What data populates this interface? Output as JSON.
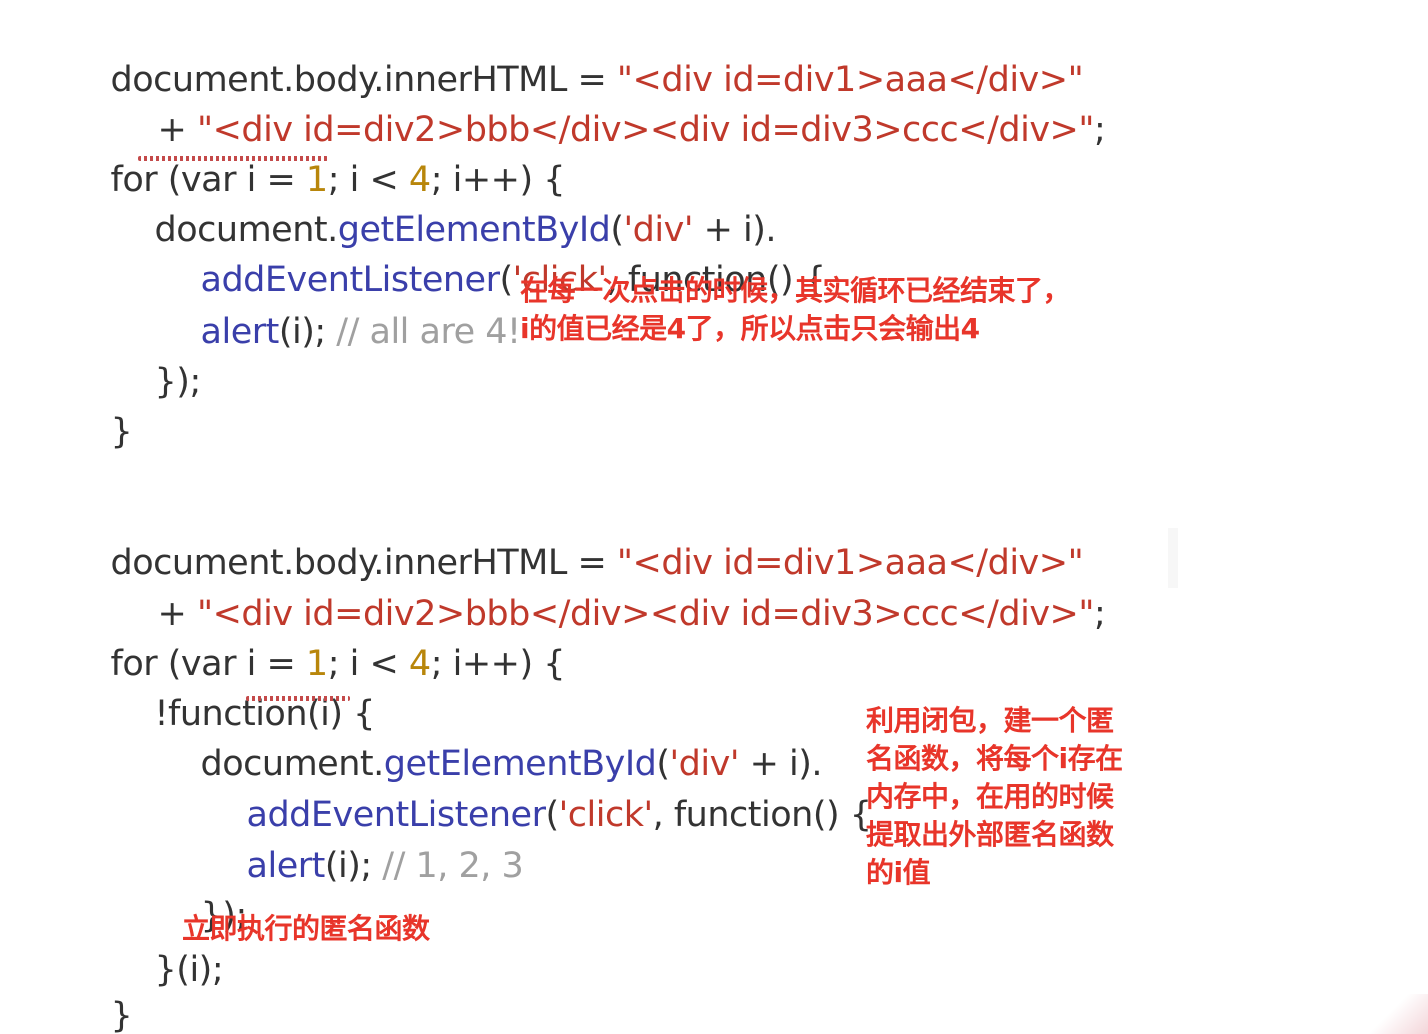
{
  "block1": {
    "line1": {
      "a": "document.body.innerHTML = ",
      "b": "\"<div id=div1>aaa</div>\""
    },
    "line2": {
      "a": "+ ",
      "b": "\"<div id=div2>bbb</div><div id=div3>ccc</div>\"",
      "c": ";"
    },
    "line3": {
      "a": "for (var i = ",
      "n1": "1",
      "b": "; i < ",
      "n2": "4",
      "c": "; i++) {"
    },
    "line4": {
      "a": "document.",
      "f": "getElementById",
      "b": "(",
      "s": "'div'",
      "c": " + i)."
    },
    "line5": {
      "f": "addEventListener",
      "b": "(",
      "s": "'click'",
      "c": ", function() {"
    },
    "line6": {
      "f": "alert",
      "b": "(i); ",
      "cmt": "// all are 4!"
    },
    "line7": "});",
    "line8": "}",
    "note": {
      "line1": "在每一次点击的时候，其实循环已经结束了，",
      "line2": "i的值已经是4了，所以点击只会输出4"
    }
  },
  "block2": {
    "line1": {
      "a": "document.body.innerHTML = ",
      "b": "\"<div id=div1>aaa</div>\""
    },
    "line2": {
      "a": "+ ",
      "b": "\"<div id=div2>bbb</div><div id=div3>ccc</div>\"",
      "c": ";"
    },
    "line3": {
      "a": "for (var i = ",
      "n1": "1",
      "b": "; i < ",
      "n2": "4",
      "c": "; i++) {"
    },
    "line4": "!function(i) {",
    "line5": {
      "a": "document.",
      "f": "getElementById",
      "b": "(",
      "s": "'div'",
      "c": " + i)."
    },
    "line6": {
      "f": "addEventListener",
      "b": "(",
      "s": "'click'",
      "c": ", function() {"
    },
    "line7": {
      "f": "alert",
      "b": "(i); ",
      "cmt": "// 1, 2, 3"
    },
    "line8": "});",
    "line9": "}(i);",
    "line10": "}",
    "note_side": {
      "line1": "利用闭包，建一个匿",
      "line2": "名函数，将每个i存在",
      "line3": "内存中，在用的时候",
      "line4": "提取出外部匿名函数",
      "line5": "的i值"
    },
    "note_inline": "立即执行的匿名函数"
  },
  "colors": {
    "string": "#c0392b",
    "number": "#b8860b",
    "function": "#3a3faa",
    "comment": "#a0a0a0",
    "annotation": "#e8352a"
  }
}
